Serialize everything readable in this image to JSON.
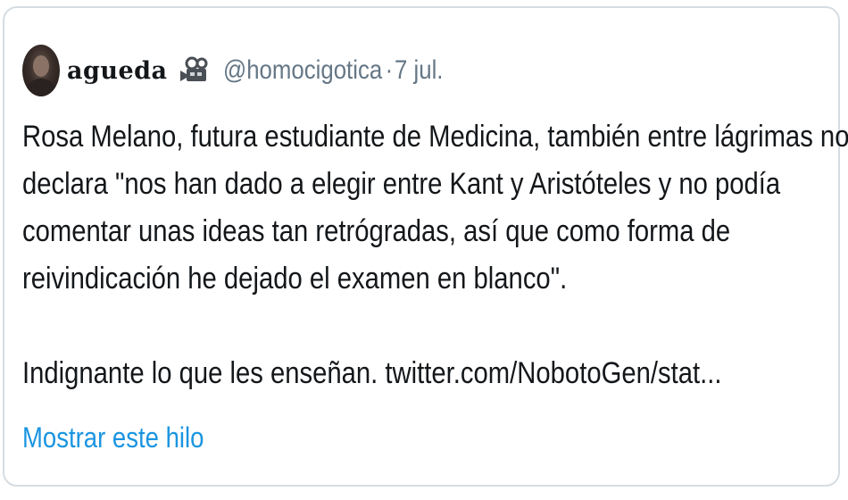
{
  "tweet": {
    "author": {
      "display_name": "agueda",
      "handle": "@homocigotica",
      "separator": "·",
      "date": "7 jul.",
      "avatar_icon": "avatar-photo",
      "emoji_icon": "movie-camera-icon"
    },
    "lines": [
      "Rosa Melano, futura estudiante de Medicina, también entre lágrimas nos",
      "declara \"nos han dado a elegir entre Kant y Aristóteles y no podía",
      "comentar unas ideas tan retrógradas, así que como forma de",
      "reivindicación he dejado el examen en blanco\"."
    ],
    "second_paragraph": "Indignante lo que les enseñan. twitter.com/NobotoGen/stat...",
    "show_thread_label": "Mostrar este hilo",
    "colors": {
      "text": "#14171a",
      "secondary": "#657786",
      "link": "#1b95e0",
      "border": "#d6dde2"
    }
  }
}
